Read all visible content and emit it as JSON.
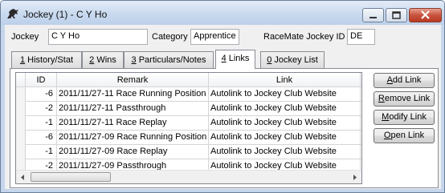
{
  "window": {
    "title": "Jockey (1) - C Y Ho"
  },
  "fields": {
    "jockey_label": "Jockey",
    "jockey_value": "C Y Ho",
    "category_label": "Category",
    "category_value": "Apprentice",
    "racemate_label": "RaceMate Jockey ID",
    "racemate_value": "DE"
  },
  "tabs": [
    {
      "key": "1",
      "label": "History/Stat"
    },
    {
      "key": "2",
      "label": "Wins"
    },
    {
      "key": "3",
      "label": "Particulars/Notes"
    },
    {
      "key": "4",
      "label": "Links"
    },
    {
      "key": "0",
      "label": "Jockey List"
    }
  ],
  "grid": {
    "columns": [
      "ID",
      "Remark",
      "Link"
    ],
    "rows": [
      {
        "id": "-6",
        "remark": "2011/11/27-11 Race Running Position R",
        "link": "Autolink to Jockey Club Website"
      },
      {
        "id": "-2",
        "remark": "2011/11/27-11 Passthrough",
        "link": "Autolink to Jockey Club Website"
      },
      {
        "id": "-1",
        "remark": "2011/11/27-11 Race Replay",
        "link": "Autolink to Jockey Club Website"
      },
      {
        "id": "-6",
        "remark": "2011/11/27-09 Race Running Position R",
        "link": "Autolink to Jockey Club Website"
      },
      {
        "id": "-1",
        "remark": "2011/11/27-09 Race Replay",
        "link": "Autolink to Jockey Club Website"
      },
      {
        "id": "-2",
        "remark": "2011/11/27-09 Passthrough",
        "link": "Autolink to Jockey Club Website"
      }
    ]
  },
  "buttons": {
    "add": {
      "key": "A",
      "rest": "dd Link"
    },
    "remove": {
      "key": "R",
      "rest": "emove Link"
    },
    "modify": {
      "key": "M",
      "rest": "odify Link"
    },
    "open": {
      "key": "O",
      "rest": "pen Link"
    }
  }
}
